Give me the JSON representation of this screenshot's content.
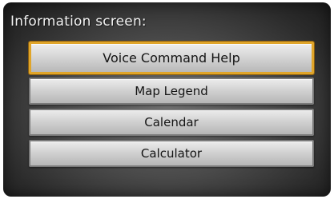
{
  "screen": {
    "title": "Information screen:"
  },
  "menu": {
    "items": [
      {
        "label": "Voice Command Help",
        "selected": true
      },
      {
        "label": "Map Legend",
        "selected": false
      },
      {
        "label": "Calendar",
        "selected": false
      },
      {
        "label": "Calculator",
        "selected": false
      }
    ]
  },
  "colors": {
    "highlight": "#e0a52a",
    "button_face": "#d2d2d2",
    "background": "#4a4a4a",
    "title_text": "#f2f2f2"
  }
}
